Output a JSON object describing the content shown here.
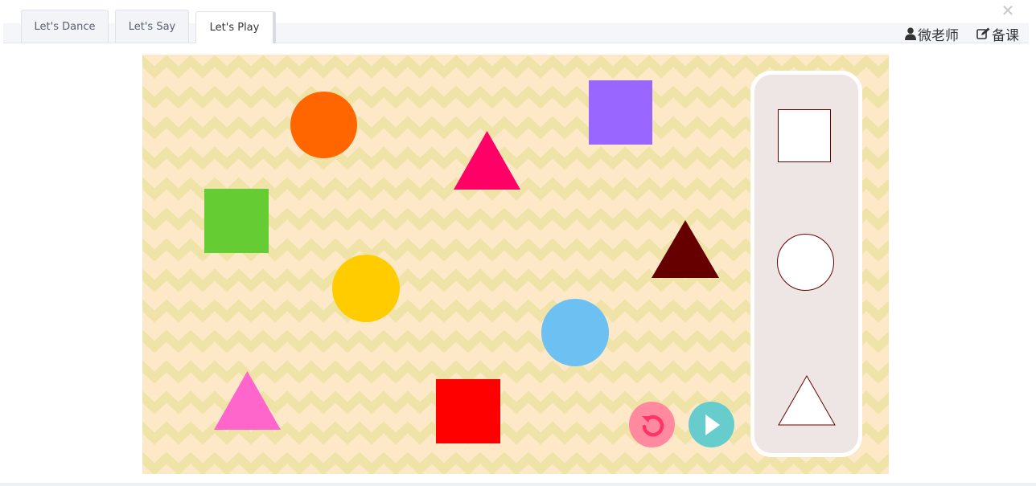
{
  "tabs": [
    {
      "label": "Let's Dance",
      "active": false
    },
    {
      "label": "Let's Say",
      "active": false
    },
    {
      "label": "Let's Play",
      "active": true
    }
  ],
  "header": {
    "close_icon": "close-icon",
    "teacher_label": "微老师",
    "teacher_icon": "user-icon",
    "prepare_label": "备课",
    "prepare_icon": "edit-icon"
  },
  "game": {
    "background_color": "#fde8c8",
    "zigzag_color": "#efe3a8",
    "shapes": [
      {
        "type": "circle",
        "color": "#ff6600"
      },
      {
        "type": "triangle",
        "color": "#ff0066"
      },
      {
        "type": "square",
        "color": "#9966ff"
      },
      {
        "type": "square",
        "color": "#66cc33"
      },
      {
        "type": "triangle",
        "color": "#660000"
      },
      {
        "type": "circle",
        "color": "#ffcc00"
      },
      {
        "type": "circle",
        "color": "#6cc0f2"
      },
      {
        "type": "triangle",
        "color": "#ff66cc"
      },
      {
        "type": "square",
        "color": "#ff0000"
      }
    ],
    "targets": [
      {
        "type": "square",
        "outline": "#660000"
      },
      {
        "type": "circle",
        "outline": "#660000"
      },
      {
        "type": "triangle",
        "outline": "#660000"
      }
    ],
    "panel_color": "#ede6e4",
    "reset_button": {
      "icon": "reset-icon",
      "color": "#ff8aa0"
    },
    "play_button": {
      "icon": "play-icon",
      "color": "#66cccc"
    }
  }
}
